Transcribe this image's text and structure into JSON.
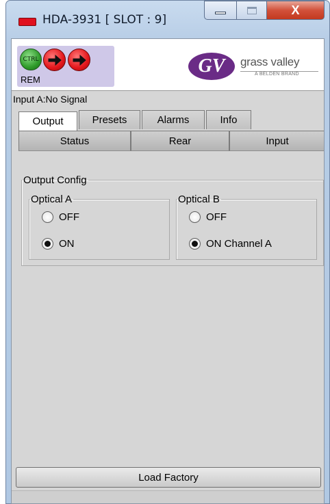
{
  "window": {
    "title": "HDA-3931 [ SLOT : 9]",
    "close_glyph": "X"
  },
  "header": {
    "ctrl_label": "CTRL",
    "rem_label": "REM",
    "logo_mark": "GV",
    "logo_text": "grass valley",
    "logo_sub": "A BELDEN BRAND"
  },
  "status": {
    "input_text": "Input A:No Signal"
  },
  "tabs_top": [
    {
      "label": "Output",
      "active": true
    },
    {
      "label": "Presets",
      "active": false
    },
    {
      "label": "Alarms",
      "active": false
    },
    {
      "label": "Info",
      "active": false
    }
  ],
  "tabs_bottom": [
    {
      "label": "Status"
    },
    {
      "label": "Rear"
    },
    {
      "label": "Input"
    }
  ],
  "output_config": {
    "title": "Output Config",
    "optical_a": {
      "title": "Optical A",
      "options": [
        {
          "label": "OFF",
          "selected": false
        },
        {
          "label": "ON",
          "selected": true
        }
      ]
    },
    "optical_b": {
      "title": "Optical B",
      "options": [
        {
          "label": "OFF",
          "selected": false
        },
        {
          "label": "ON Channel A",
          "selected": true
        }
      ]
    }
  },
  "footer": {
    "load_factory_label": "Load Factory"
  },
  "colors": {
    "status_red": "#e3161b",
    "status_green": "#2f9b2a",
    "brand_purple": "#6a2b86"
  }
}
